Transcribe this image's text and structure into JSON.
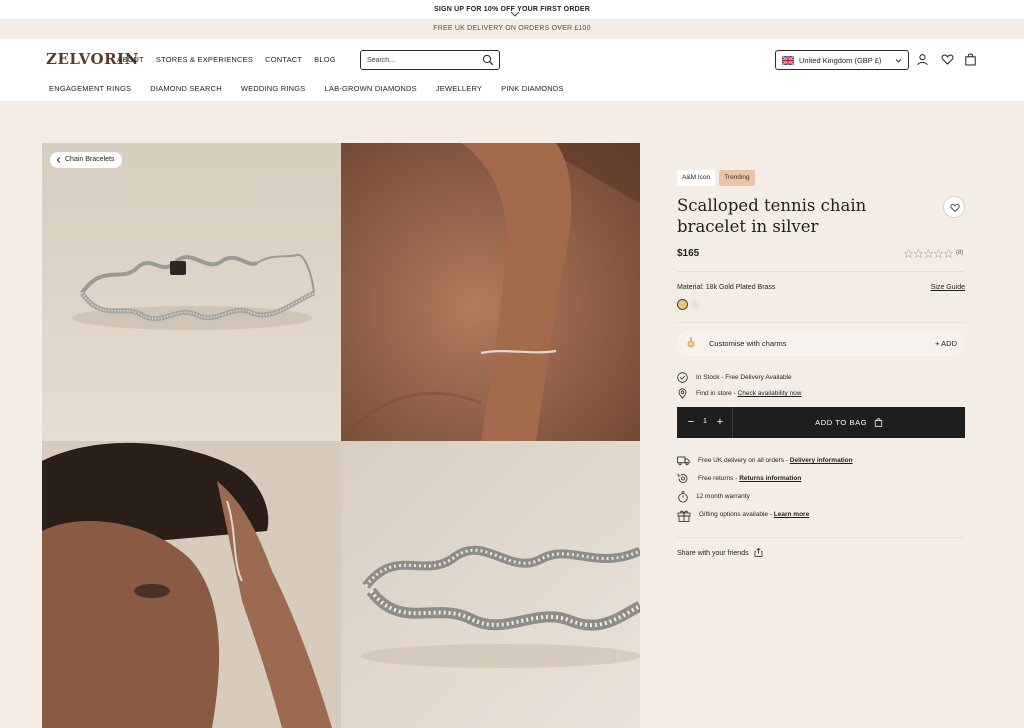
{
  "promo": {
    "top": "SIGN UP FOR 10% OFF YOUR FIRST ORDER",
    "delivery": "FREE UK DELIVERY ON ORDERS OVER £100"
  },
  "header": {
    "logo": "ZELVORIN",
    "nav": [
      "ABOUT",
      "STORES & EXPERIENCES",
      "CONTACT",
      "BLOG"
    ],
    "search_placeholder": "Search...",
    "country": "United Kingdom (GBP £)",
    "sub_nav": [
      "ENGAGEMENT RINGS",
      "DIAMOND SEARCH",
      "WEDDING RINGS",
      "LAB-GROWN DIAMONDS",
      "JEWELLERY",
      "PINK DIAMONDS"
    ]
  },
  "gallery": {
    "back_label": "Chain Bracelets"
  },
  "product": {
    "badges": [
      "A&M Icon",
      "Trending"
    ],
    "title": "Scalloped tennis chain bracelet in silver",
    "price": "$165",
    "rating": 0,
    "review_count": "(8)",
    "material": "Material: 18k Gold Plated Brass",
    "size_guide": "Size Guide",
    "swatches": [
      "#f0c27b",
      "#e2e2e2"
    ],
    "customise_label": "Customise with charms",
    "customise_add": "+ ADD",
    "stock": {
      "text": "In Stock - Free Delivery Available"
    },
    "find_store": {
      "text": "Find in store - ",
      "link": "Check availability now"
    },
    "quantity": "1",
    "add_to_bag": "ADD TO BAG",
    "delivery": {
      "text": "Free UK delivery on all orders - ",
      "link": "Delivery information"
    },
    "returns": {
      "text": "Free returns - ",
      "link": "Returns information"
    },
    "warranty": "12 month warranty",
    "gifting": {
      "text": "Gifting options available - ",
      "link": "Learn more"
    },
    "share": "Share with your friends"
  },
  "colors": {
    "background": "#f4ede6",
    "accent": "#e8c4a8",
    "dark": "#1e1e1e",
    "logo": "#5a3b28"
  }
}
